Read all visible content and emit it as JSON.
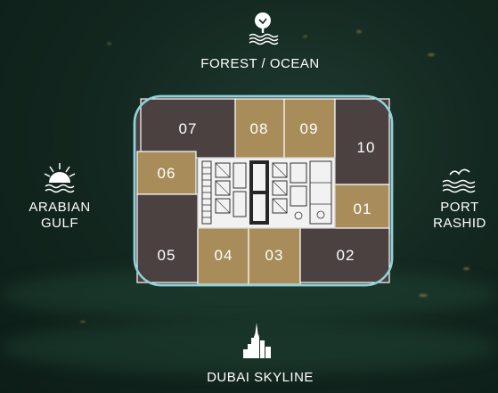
{
  "directions": {
    "top": {
      "label": "FOREST / OCEAN",
      "icon": "tree-waves-icon"
    },
    "left": {
      "line1": "ARABIAN",
      "line2": "GULF",
      "icon": "sunset-icon"
    },
    "right": {
      "line1": "PORT",
      "line2": "RASHID",
      "icon": "seagull-waves-icon"
    },
    "bottom": {
      "label": "DUBAI SKYLINE",
      "icon": "skyline-icon"
    }
  },
  "units": {
    "u01": "01",
    "u02": "02",
    "u03": "03",
    "u04": "04",
    "u05": "05",
    "u06": "06",
    "u07": "07",
    "u08": "08",
    "u09": "09",
    "u10": "10"
  },
  "colors": {
    "highlight": "#a88c5a",
    "standard": "#4a4140",
    "outline": "#8fd3dc",
    "core": "#f2f2f2"
  }
}
